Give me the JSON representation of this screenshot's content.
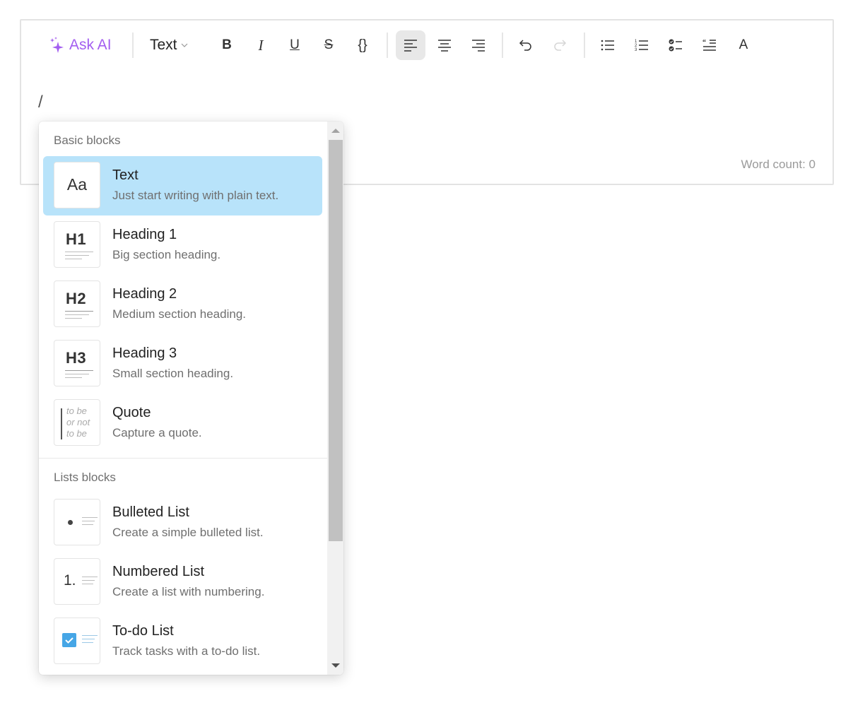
{
  "toolbar": {
    "ask_ai_label": "Ask AI",
    "block_type_label": "Text",
    "buttons": {
      "bold": "B",
      "italic": "I",
      "underline": "U",
      "strikethrough": "S",
      "code": "{}",
      "font_color": "A"
    },
    "accent_color": "#a35ef0"
  },
  "editor": {
    "content": "/",
    "word_count": "Word count: 0"
  },
  "menu": {
    "sections": [
      {
        "label": "Basic blocks",
        "items": [
          {
            "title": "Text",
            "description": "Just start writing with plain text.",
            "thumb": "Aa",
            "selected": true
          },
          {
            "title": "Heading 1",
            "description": "Big section heading.",
            "thumb": "H1"
          },
          {
            "title": "Heading 2",
            "description": "Medium section heading.",
            "thumb": "H2"
          },
          {
            "title": "Heading 3",
            "description": "Small section heading.",
            "thumb": "H3"
          },
          {
            "title": "Quote",
            "description": "Capture a quote.",
            "thumb_lines": [
              "to be",
              "or not",
              "to be"
            ]
          }
        ]
      },
      {
        "label": "Lists blocks",
        "items": [
          {
            "title": "Bulleted List",
            "description": "Create a simple bulleted list.",
            "thumb": "•"
          },
          {
            "title": "Numbered List",
            "description": "Create a list with numbering.",
            "thumb": "1."
          },
          {
            "title": "To-do List",
            "description": "Track tasks with a to-do list."
          }
        ]
      }
    ],
    "selected_color": "#b8e3fa"
  }
}
